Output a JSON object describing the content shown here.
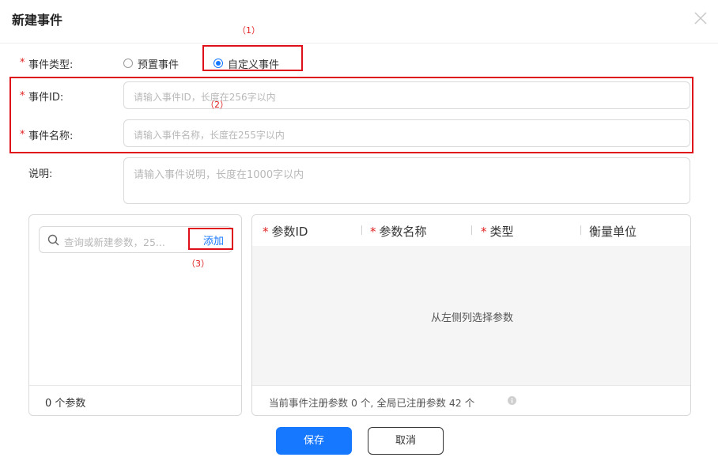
{
  "dialog": {
    "title": "新建事件"
  },
  "annotations": {
    "a1": "（1）",
    "a2": "（2）",
    "a3": "（3）"
  },
  "form": {
    "required_mark": "*",
    "event_type": {
      "label": "事件类型:",
      "options": [
        "预置事件",
        "自定义事件"
      ],
      "selected": "自定义事件"
    },
    "event_id": {
      "label": "事件ID:",
      "placeholder": "请输入事件ID，长度在256字以内"
    },
    "event_name": {
      "label": "事件名称:",
      "placeholder": "请输入事件名称，长度在255字以内"
    },
    "description": {
      "label": "说明:",
      "placeholder": "请输入事件说明，长度在1000字以内"
    }
  },
  "params_left": {
    "search_placeholder": "查询或新建参数，25...",
    "add_label": "添加",
    "count_text": "0 个参数"
  },
  "params_right": {
    "columns": [
      "参数ID",
      "参数名称",
      "类型",
      "衡量单位"
    ],
    "required_columns": [
      true,
      true,
      true,
      false
    ],
    "empty_text": "从左侧列选择参数",
    "footer_text": "当前事件注册参数 0 个, 全局已注册参数 42 个"
  },
  "footer": {
    "save_label": "保存",
    "cancel_label": "取消"
  },
  "colors": {
    "primary": "#1677ff",
    "annotation_red": "#e0101a",
    "required_red": "#e02020"
  },
  "icons": [
    "close-icon",
    "search-icon",
    "info-icon"
  ]
}
